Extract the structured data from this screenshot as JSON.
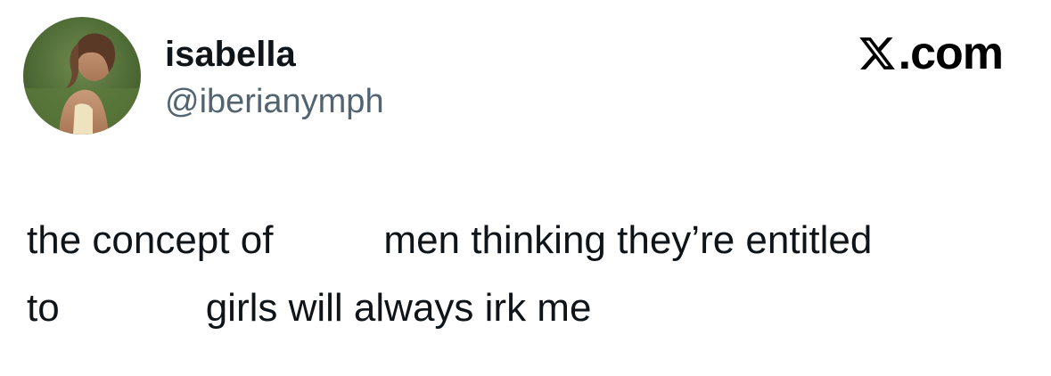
{
  "post": {
    "author": {
      "display_name": "isabella",
      "handle": "@iberianymph",
      "avatar": "profile-photo"
    },
    "site": {
      "logo_icon": "x-logo-icon",
      "domain": ".com"
    },
    "text": {
      "line1_part1": "the concept of",
      "line1_part2": "men thinking they’re entitled",
      "line2_part1": "to",
      "line2_part2": "girls will always irk me"
    }
  },
  "colors": {
    "text_primary": "#0f1419",
    "text_secondary": "#536471",
    "background": "#ffffff",
    "logo": "#000000"
  }
}
